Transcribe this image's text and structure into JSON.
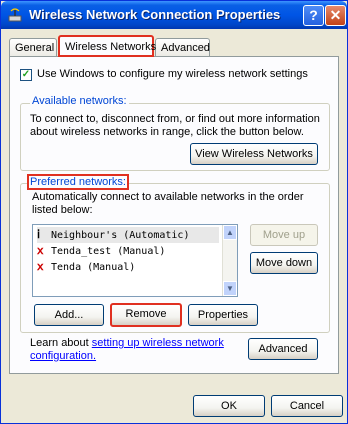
{
  "window": {
    "title": "Wireless Network Connection Properties",
    "help_label": "?",
    "close_label": "✕"
  },
  "tabs": [
    {
      "label": "General"
    },
    {
      "label": "Wireless Networks"
    },
    {
      "label": "Advanced"
    }
  ],
  "use_windows_checkbox": {
    "label": "Use Windows to configure my wireless network settings",
    "checked": true,
    "check_mark": "✓"
  },
  "available": {
    "title": "Available networks:",
    "description": "To connect to, disconnect from, or find out more information about wireless networks in range, click the button below.",
    "view_button": "View Wireless Networks"
  },
  "preferred": {
    "title": "Preferred networks:",
    "description": "Automatically connect to available networks in the order listed below:",
    "networks": [
      {
        "name": "Neighbour's (Automatic)"
      },
      {
        "name": "Tenda_test (Manual)"
      },
      {
        "name": "Tenda (Manual)"
      }
    ],
    "move_up": "Move up",
    "move_down": "Move down",
    "add": "Add...",
    "remove": "Remove",
    "properties": "Properties"
  },
  "learn": {
    "prefix": "Learn about",
    "link": "setting up wireless network configuration.",
    "advanced_button": "Advanced"
  },
  "footer": {
    "ok": "OK",
    "cancel": "Cancel"
  }
}
